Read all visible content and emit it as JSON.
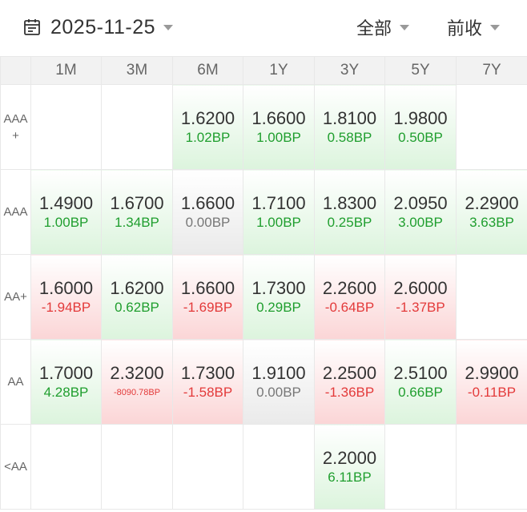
{
  "header": {
    "date": "2025-11-25",
    "filter_all": "全部",
    "filter_close": "前收"
  },
  "columns": [
    "1M",
    "3M",
    "6M",
    "1Y",
    "3Y",
    "5Y",
    "7Y"
  ],
  "rows": [
    {
      "label": "AAA +",
      "cells": [
        null,
        null,
        {
          "rate": "1.6200",
          "change": "1.02BP",
          "dir": "up"
        },
        {
          "rate": "1.6600",
          "change": "1.00BP",
          "dir": "up"
        },
        {
          "rate": "1.8100",
          "change": "0.58BP",
          "dir": "up"
        },
        {
          "rate": "1.9800",
          "change": "0.50BP",
          "dir": "up"
        },
        null
      ]
    },
    {
      "label": "AAA",
      "cells": [
        {
          "rate": "1.4900",
          "change": "1.00BP",
          "dir": "up"
        },
        {
          "rate": "1.6700",
          "change": "1.34BP",
          "dir": "up"
        },
        {
          "rate": "1.6600",
          "change": "0.00BP",
          "dir": "flat"
        },
        {
          "rate": "1.7100",
          "change": "1.00BP",
          "dir": "up"
        },
        {
          "rate": "1.8300",
          "change": "0.25BP",
          "dir": "up"
        },
        {
          "rate": "2.0950",
          "change": "3.00BP",
          "dir": "up"
        },
        {
          "rate": "2.2900",
          "change": "3.63BP",
          "dir": "up"
        }
      ]
    },
    {
      "label": "AA+",
      "cells": [
        {
          "rate": "1.6000",
          "change": "-1.94BP",
          "dir": "down"
        },
        {
          "rate": "1.6200",
          "change": "0.62BP",
          "dir": "up"
        },
        {
          "rate": "1.6600",
          "change": "-1.69BP",
          "dir": "down"
        },
        {
          "rate": "1.7300",
          "change": "0.29BP",
          "dir": "up"
        },
        {
          "rate": "2.2600",
          "change": "-0.64BP",
          "dir": "down"
        },
        {
          "rate": "2.6000",
          "change": "-1.37BP",
          "dir": "down"
        },
        null
      ]
    },
    {
      "label": "AA",
      "cells": [
        {
          "rate": "1.7000",
          "change": "4.28BP",
          "dir": "up"
        },
        {
          "rate": "2.3200",
          "change": "-8090.78BP",
          "dir": "down",
          "small": true
        },
        {
          "rate": "1.7300",
          "change": "-1.58BP",
          "dir": "down"
        },
        {
          "rate": "1.9100",
          "change": "0.00BP",
          "dir": "flat"
        },
        {
          "rate": "2.2500",
          "change": "-1.36BP",
          "dir": "down"
        },
        {
          "rate": "2.5100",
          "change": "0.66BP",
          "dir": "up"
        },
        {
          "rate": "2.9900",
          "change": "-0.11BP",
          "dir": "down"
        }
      ]
    },
    {
      "label": "<AA",
      "cells": [
        null,
        null,
        null,
        null,
        {
          "rate": "2.2000",
          "change": "6.11BP",
          "dir": "up"
        },
        null,
        null
      ]
    }
  ],
  "colors": {
    "positive": "#1f9e2e",
    "negative": "#e33a3a",
    "neutral": "#777777",
    "up_fill": "#dcf4dd",
    "down_fill": "#fbd5d6",
    "flat_fill": "#eaeaea"
  }
}
